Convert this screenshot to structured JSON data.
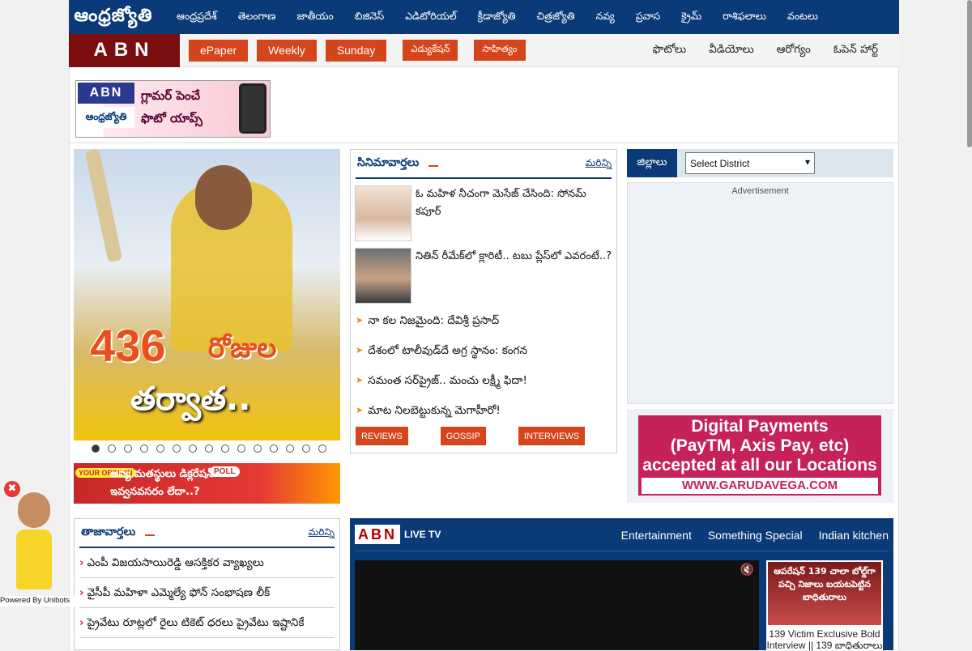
{
  "topnav": {
    "logo_text": "ఆంధ్రజ్యోతి",
    "items": [
      "ఆంధ్రప్రదేశ్",
      "తెలంగాణ",
      "జాతీయం",
      "బిజినెస్",
      "ఎడిటోరియల్",
      "క్రీడాజ్యోతి",
      "చిత్రజ్యోతి",
      "నవ్య",
      "ప్రవాస",
      "క్రైమ్",
      "రాశిఫలాలు",
      "వంటలు"
    ]
  },
  "subnav": {
    "abn": "ABN",
    "pills": [
      "ePaper",
      "Weekly",
      "Sunday"
    ],
    "te_pills": [
      "ఎడ్యుకేషన్",
      "సాహిత్యం"
    ],
    "right_links": [
      "ఫొటోలు",
      "వీడియోలు",
      "ఆరోగ్యం",
      "ఓపెన్ హార్ట్"
    ]
  },
  "banner": {
    "abn": "ABN",
    "brand": "ఆంధ్రజ్యోతి",
    "text_line1": "గ్లామర్ పెంచే",
    "text_line2": "ఫొటో యాప్స్"
  },
  "slider": {
    "caption_number": "436",
    "caption_word": "రోజుల",
    "caption_line2": "తర్వాత..",
    "dots": 15,
    "active_dot": 0
  },
  "poll": {
    "tag_left": "YOUR OPINION",
    "text_line1": "అన్య మతస్థులు డిక్లరేషన్",
    "tag": "POLL",
    "text_line2": "ఇవ్వనవసరం లేదా..?"
  },
  "cinema": {
    "title": "సినిమావార్తలు",
    "more": "మరిన్ని",
    "stories": [
      {
        "text": "ఓ మహిళ నీచంగా మెసేజ్ చేసింది: సోనమ్ కపూర్"
      },
      {
        "text": "నితిన్ రీమేక్‌లో క్లారిటీ.. టబు ప్లేస్‌లో ఎవరంటే..?"
      }
    ],
    "list": [
      "నా కల నిజమైంది: దేవిశ్రీ ప్రసాద్",
      "దేశంలో టాలీవుడ్‌దే అగ్ర స్థానం: కంగన",
      "సమంత సర్‌ప్రైజ్.. మంచు లక్ష్మీ ఫిదా!",
      "మాట నిలబెట్టుకున్న మెగాహీరో!"
    ],
    "tags": [
      "REVIEWS",
      "GOSSIP",
      "INTERVIEWS"
    ]
  },
  "district": {
    "label": "జిల్లాలు",
    "select": "Select District"
  },
  "ad": {
    "label": "Advertisement"
  },
  "garuda": {
    "line1": "Digital Payments",
    "line2": "(PayTM, Axis Pay, etc)",
    "line3": "accepted at all our Locations",
    "url": "WWW.GARUDAVEGA.COM"
  },
  "latest": {
    "title": "తాజావార్తలు",
    "more": "మరిన్ని",
    "items": [
      "ఎంపీ విజయసాయిరెడ్డి ఆసక్తికర వ్యాఖ్యలు",
      "వైసీపీ మహిళా ఎమ్మెల్యే ఫోన్ సంభాషణ లీక్",
      "ప్రైవేటు రూట్లలో రైలు టికెట్ ధరలు ప్రైవేటు ఇష్టానికే"
    ]
  },
  "live": {
    "logo": "ABN",
    "logo_sub": "LIVE TV",
    "links": [
      "Entertainment",
      "Something Special",
      "Indian kitchen"
    ],
    "side_image_text": "ఆపరేషన్ 139 చాలా బోల్డ్‌గా పచ్చి నిజాలు బయటపెట్టిన బాధితురాలు",
    "side_title": "139 Victim Exclusive Bold Interview || 139 బాధితురాలు"
  },
  "widget": {
    "powered": "Powered By Unibots",
    "close": "✖"
  }
}
